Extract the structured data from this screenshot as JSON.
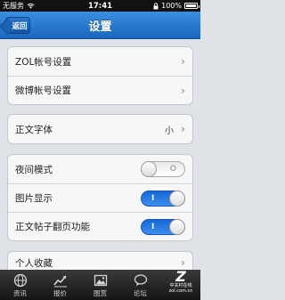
{
  "status_bar": {
    "carrier": "无服务",
    "time": "17:41",
    "battery": "100%"
  },
  "nav": {
    "back_label": "返回",
    "title": "设置"
  },
  "group_accounts": [
    {
      "label": "ZOL帐号设置"
    },
    {
      "label": "微博帐号设置"
    }
  ],
  "group_font": {
    "label": "正文字体",
    "value": "小"
  },
  "group_toggles": [
    {
      "label": "夜间模式",
      "state": "off",
      "glyph": "O"
    },
    {
      "label": "图片显示",
      "state": "on",
      "glyph": "I"
    },
    {
      "label": "正文帖子翻页功能",
      "state": "on",
      "glyph": "I"
    }
  ],
  "group_more": {
    "label": "个人收藏"
  },
  "tabs": [
    {
      "label": "资讯",
      "icon": "globe-icon"
    },
    {
      "label": "报价",
      "icon": "trend-chart-icon"
    },
    {
      "label": "图赏",
      "icon": "picture-icon"
    },
    {
      "label": "论坛",
      "icon": "speech-bubble-icon"
    }
  ],
  "watermark": {
    "logo": "Z",
    "line1": "中关村在线",
    "line2": "zol.com.cn"
  },
  "colors": {
    "nav_blue": "#1a66bf",
    "toggle_on": "#1667d4",
    "page_bg": "#dfe3e8"
  }
}
